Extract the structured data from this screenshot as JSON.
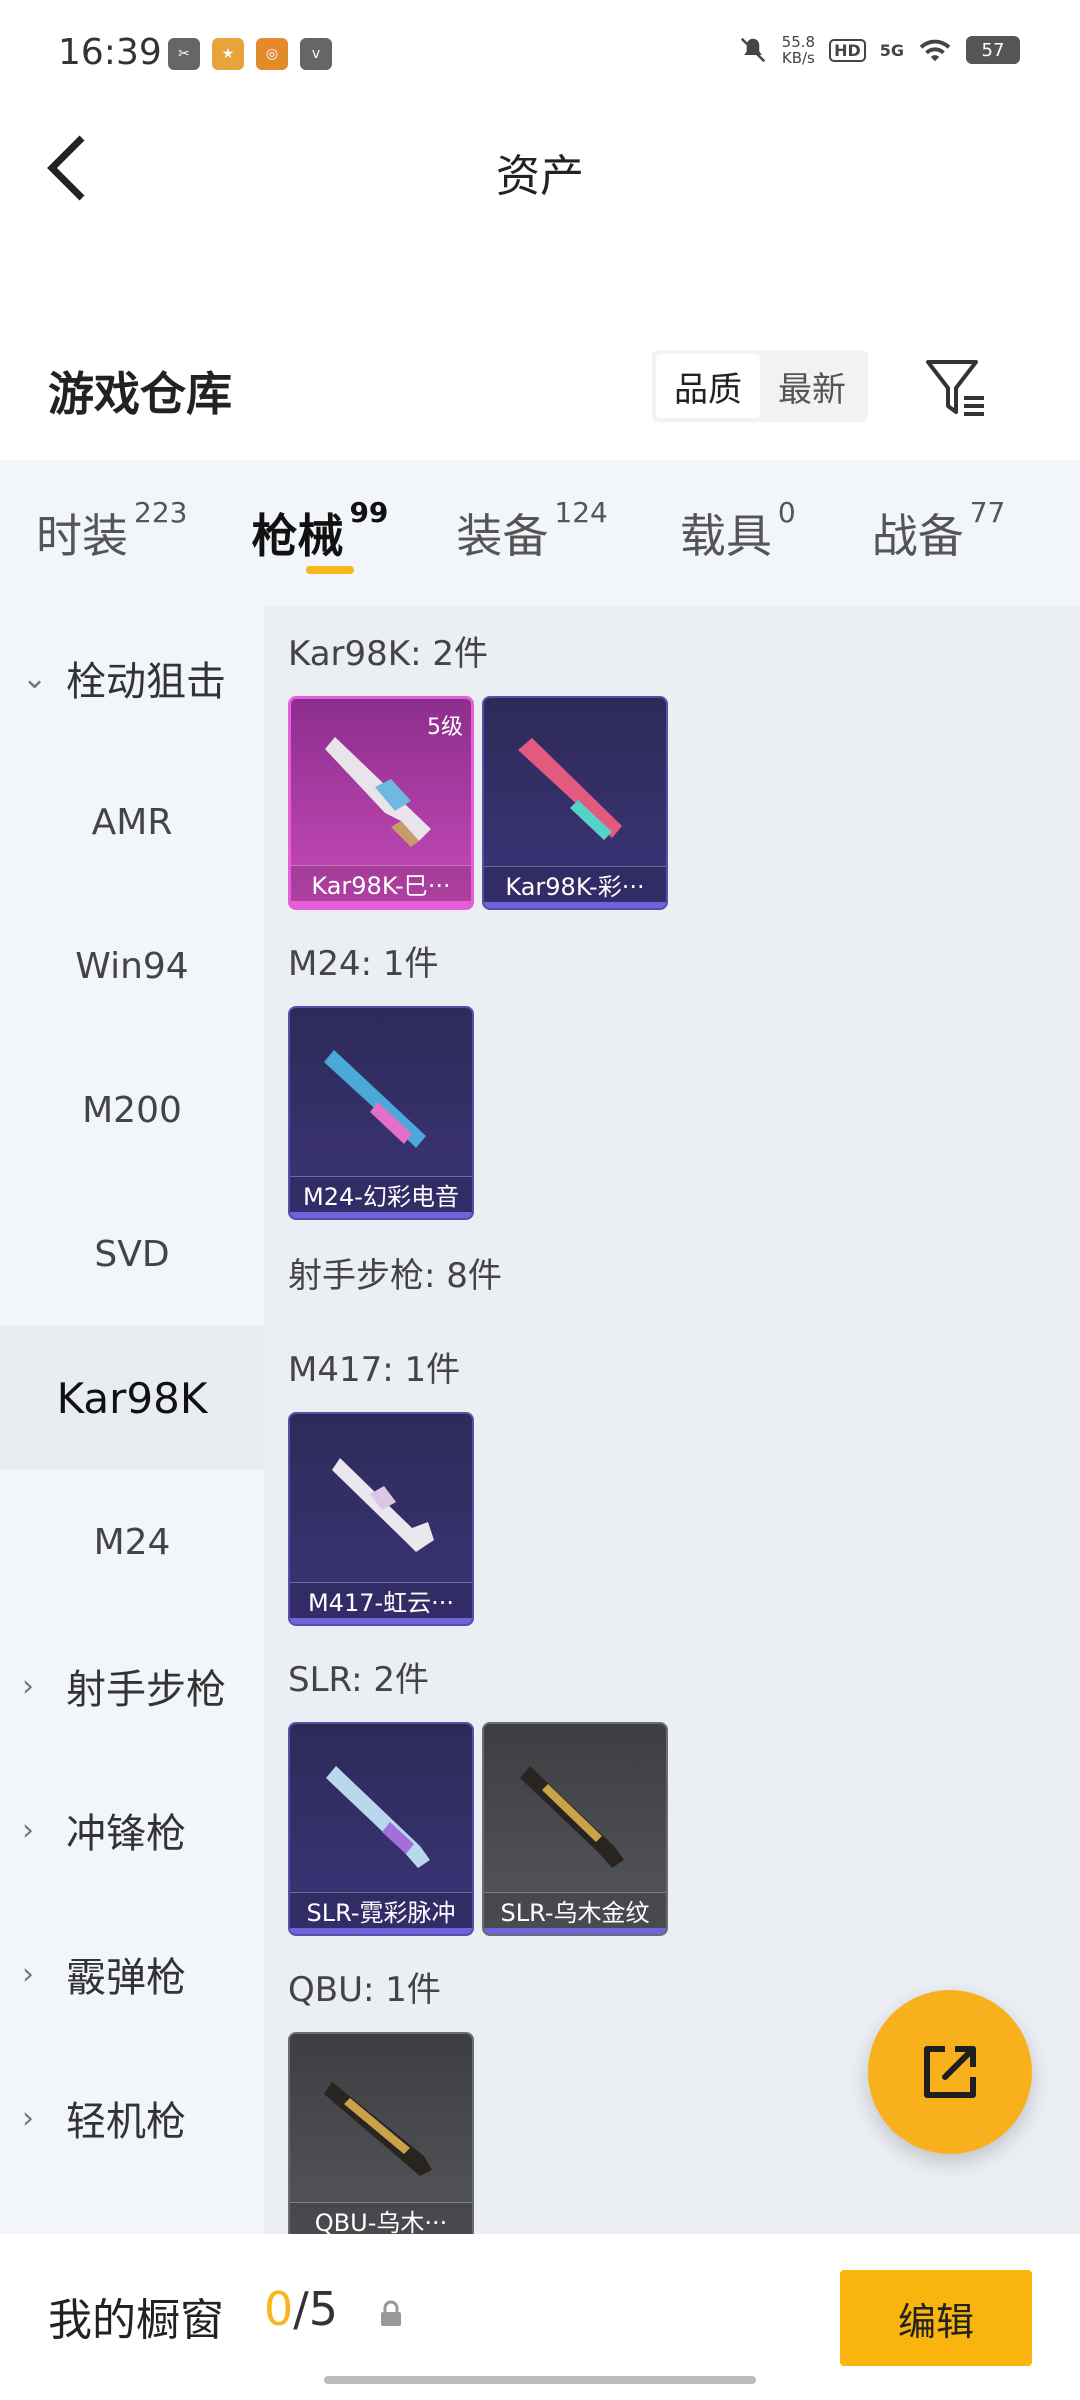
{
  "status_bar": {
    "time": "16:39",
    "speed_value": "55.8",
    "speed_unit": "KB/s",
    "hd": "HD",
    "network": "5G",
    "battery": "57"
  },
  "header": {
    "title": "资产"
  },
  "warehouse": {
    "title": "游戏仓库",
    "sort_options": [
      "品质",
      "最新"
    ],
    "sort_active": "品质"
  },
  "tabs": [
    {
      "label": "时装",
      "count": "223"
    },
    {
      "label": "枪械",
      "count": "99",
      "active": true
    },
    {
      "label": "装备",
      "count": "124"
    },
    {
      "label": "载具",
      "count": "0"
    },
    {
      "label": "战备",
      "count": "77"
    }
  ],
  "sidebar": [
    {
      "label": "栓动狙击",
      "type": "category",
      "expanded": true
    },
    {
      "label": "AMR",
      "type": "sub"
    },
    {
      "label": "Win94",
      "type": "sub"
    },
    {
      "label": "M200",
      "type": "sub"
    },
    {
      "label": "SVD",
      "type": "sub"
    },
    {
      "label": "Kar98K",
      "type": "sub",
      "active": true
    },
    {
      "label": "M24",
      "type": "sub"
    },
    {
      "label": "射手步枪",
      "type": "category",
      "expanded": false
    },
    {
      "label": "冲锋枪",
      "type": "category",
      "expanded": false
    },
    {
      "label": "霰弹枪",
      "type": "category",
      "expanded": false
    },
    {
      "label": "轻机枪",
      "type": "category",
      "expanded": false
    }
  ],
  "content": {
    "groups": [
      {
        "title": "Kar98K: 2件",
        "items": [
          {
            "name": "Kar98K-巳···",
            "level": "5级",
            "style": "pink"
          },
          {
            "name": "Kar98K-彩···",
            "style": "purple"
          }
        ]
      },
      {
        "title": "M24: 1件",
        "items": [
          {
            "name": "M24-幻彩电音",
            "style": "purple"
          }
        ]
      },
      {
        "title": "射手步枪: 8件",
        "items": []
      },
      {
        "title": "M417: 1件",
        "items": [
          {
            "name": "M417-虹云···",
            "style": "purple"
          }
        ]
      },
      {
        "title": "SLR: 2件",
        "items": [
          {
            "name": "SLR-霓彩脉冲",
            "style": "purple"
          },
          {
            "name": "SLR-乌木金纹",
            "style": "gray"
          }
        ]
      },
      {
        "title": "QBU: 1件",
        "items": [
          {
            "name": "QBU-乌木···",
            "style": "gray"
          }
        ]
      }
    ]
  },
  "bottom_bar": {
    "title": "我的橱窗",
    "count_current": "0",
    "count_total": "/5",
    "edit_label": "编辑"
  },
  "colors": {
    "accent": "#f7b51e",
    "pink_rarity": "#c84ab7",
    "purple_rarity": "#3c3479",
    "gray_rarity": "#55575c"
  },
  "icons": {
    "back": "back-arrow-icon",
    "filter": "filter-icon",
    "share": "share-export-icon",
    "lock": "lock-icon"
  }
}
